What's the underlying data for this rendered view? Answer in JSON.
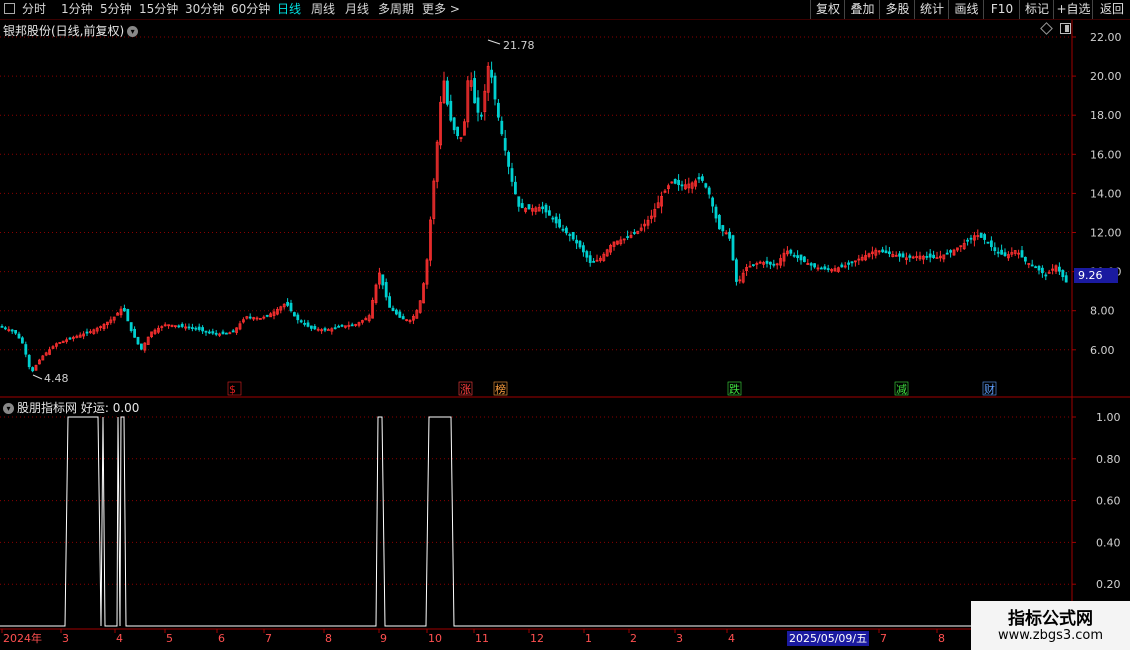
{
  "toolbar": {
    "periods": [
      "分时",
      "1分钟",
      "5分钟",
      "15分钟",
      "30分钟",
      "60分钟",
      "日线",
      "周线",
      "月线",
      "多周期",
      "更多 >"
    ],
    "active": "日线",
    "right_buttons": [
      "复权",
      "叠加",
      "多股",
      "统计",
      "画线",
      "F10",
      "标记",
      "+自选",
      "返回"
    ]
  },
  "main_panel": {
    "title": "银邦股份(日线,前复权)",
    "y_ticks": [
      "22.00",
      "20.00",
      "18.00",
      "16.00",
      "14.00",
      "12.00",
      "10.00",
      "8.00",
      "6.00"
    ],
    "high_label": "21.78",
    "low_label": "4.48",
    "current_price": "9.26",
    "event_marks": [
      {
        "text": "$",
        "color": "#e02020"
      },
      {
        "text": "涨",
        "color": "#ff4040"
      },
      {
        "text": "榜",
        "color": "#ffa040"
      },
      {
        "text": "跌",
        "color": "#40e040"
      },
      {
        "text": "减",
        "color": "#40e040"
      },
      {
        "text": "财",
        "color": "#60a0ff"
      }
    ]
  },
  "sub_panel": {
    "title": "股朋指标网",
    "indicator_label": "好运:",
    "indicator_value": "0.00",
    "y_ticks": [
      "1.00",
      "0.80",
      "0.60",
      "0.40",
      "0.20"
    ]
  },
  "x_axis": {
    "labels": [
      "2024年",
      "3",
      "4",
      "5",
      "6",
      "7",
      "8",
      "9",
      "10",
      "11",
      "12",
      "1",
      "2",
      "3",
      "4",
      "5",
      "6",
      "7",
      "8"
    ],
    "cursor_date": "2025/05/09/五"
  },
  "watermark": {
    "line1": "指标公式网",
    "line2": "www.zbgs3.com"
  },
  "colors": {
    "up": "#ff3030",
    "down": "#00d0d0",
    "grid": "#8a0000",
    "axis": "#a00000",
    "indicator": "#ffffff"
  }
}
